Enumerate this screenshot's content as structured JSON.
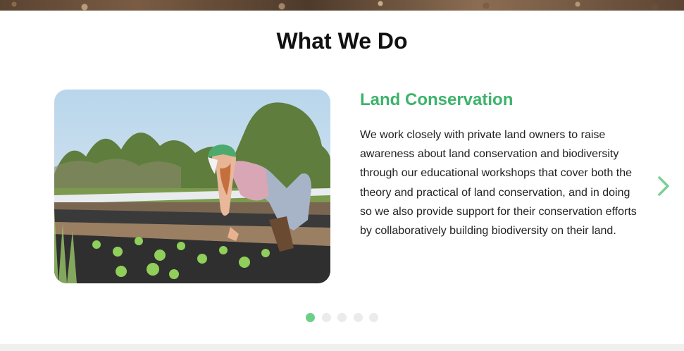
{
  "section": {
    "title": "What We Do"
  },
  "slide": {
    "heading": "Land Conservation",
    "body": "We work closely with private land owners to raise awareness about land conservation and biodiversity through our educational workshops that cover both the theory and practical of land conservation, and in doing so we also provide support for their conservation efforts by collaboratively building biodiversity on their land."
  },
  "carousel": {
    "next_icon": "chevron-right-icon",
    "slide_count": 5,
    "active_index": 0
  },
  "colors": {
    "accent": "#3db36b",
    "dot_active": "#6ccf86",
    "dot_inactive": "#ebebeb"
  }
}
